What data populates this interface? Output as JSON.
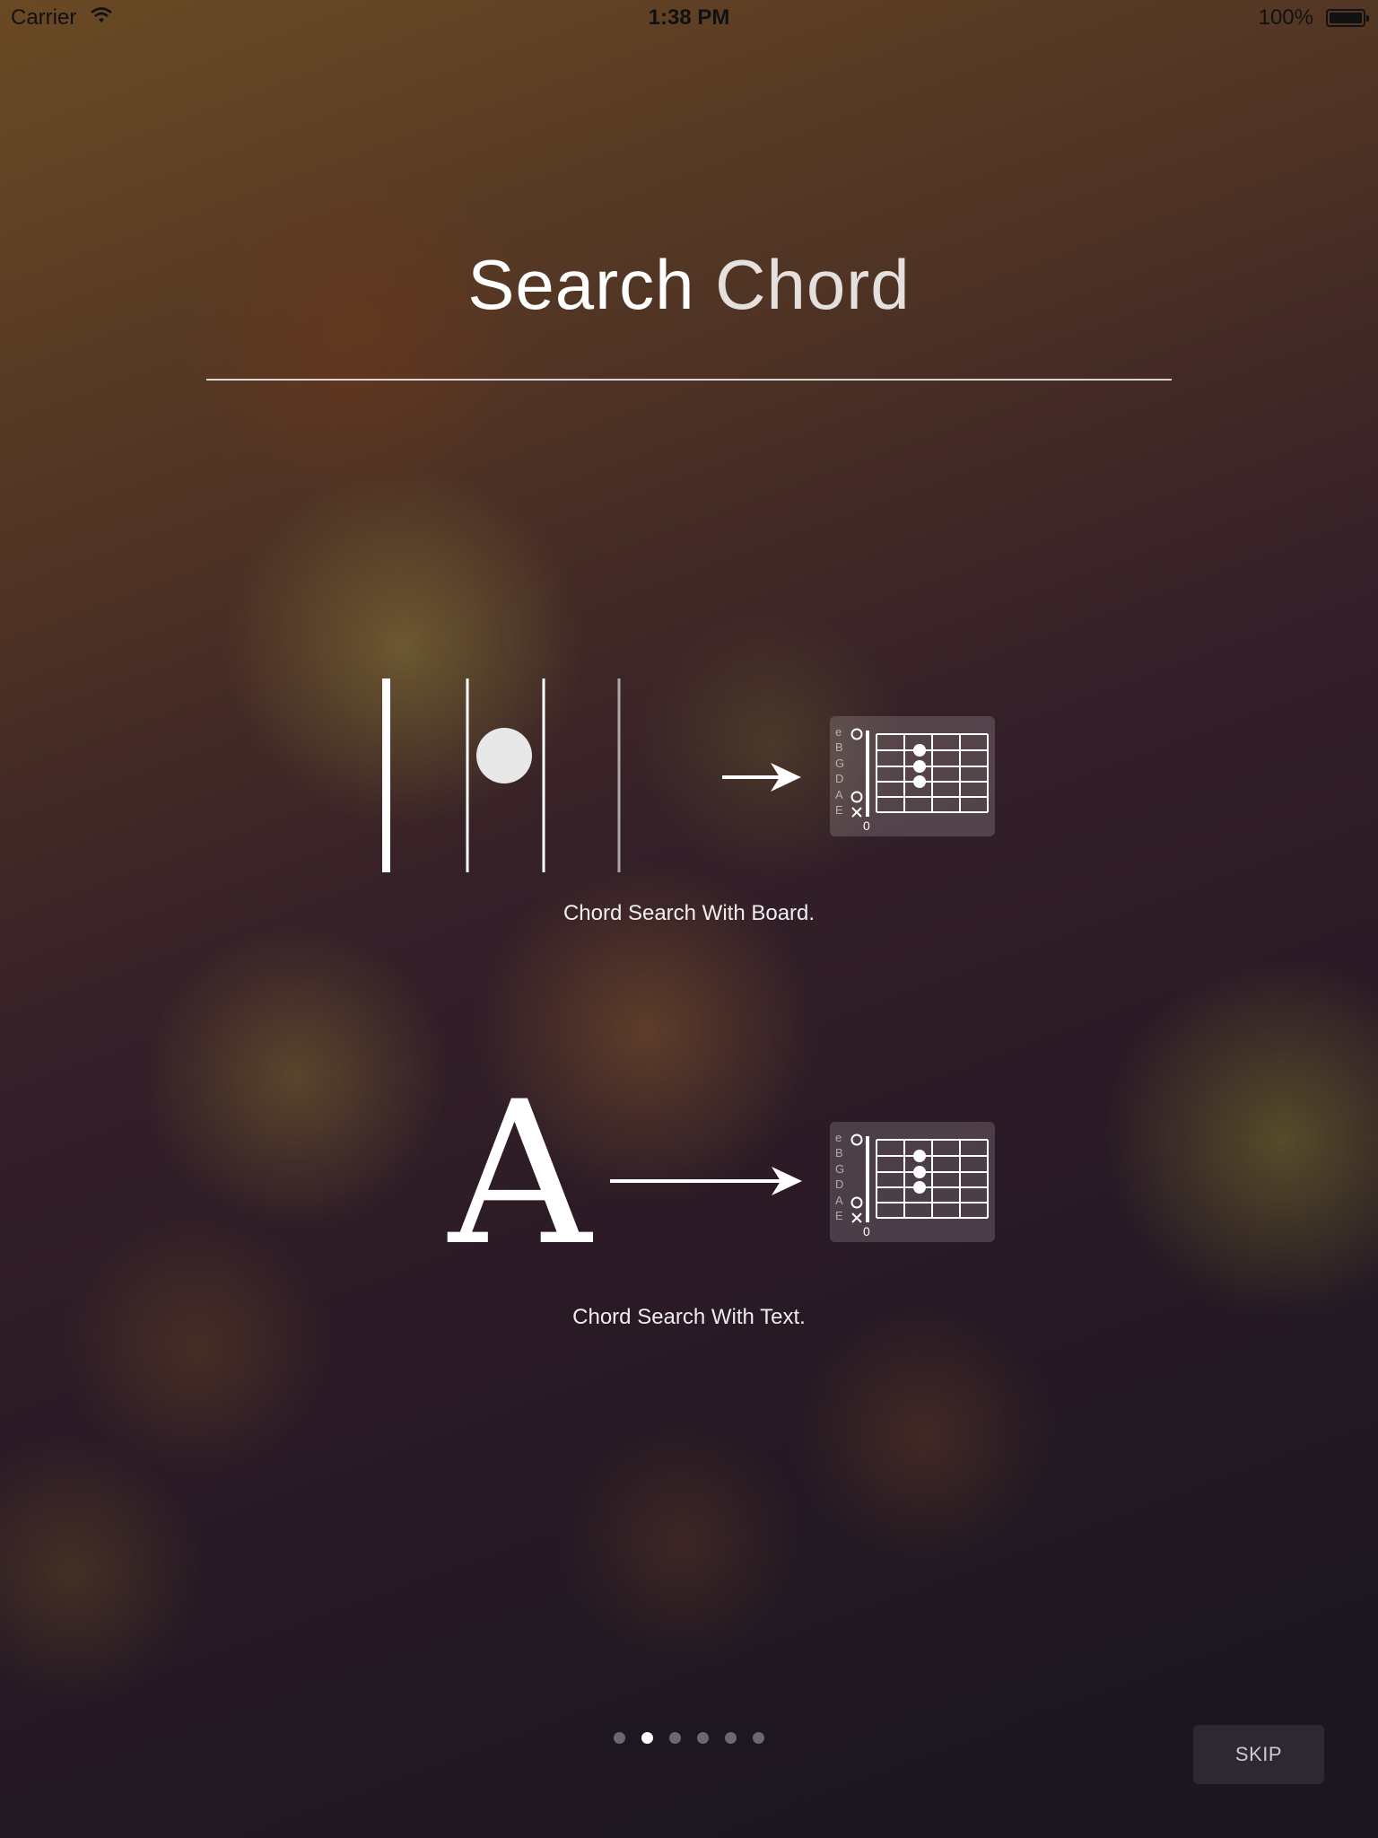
{
  "status_bar": {
    "carrier": "Carrier",
    "time": "1:38 PM",
    "battery": "100%"
  },
  "title": {
    "strong": "Search",
    "light": "Chord"
  },
  "feature_board": {
    "caption": "Chord Search With Board."
  },
  "feature_text": {
    "letter": "A",
    "caption": "Chord Search With Text."
  },
  "chord_diagram": {
    "strings": [
      "e",
      "B",
      "G",
      "D",
      "A",
      "E"
    ],
    "fret_label": "0"
  },
  "pager": {
    "count": 6,
    "active": 1
  },
  "skip_label": "SKIP"
}
